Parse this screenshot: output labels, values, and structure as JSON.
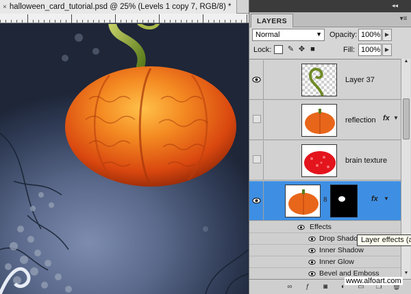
{
  "document": {
    "tab_title": "halloween_card_tutorial.psd @ 25% (Levels 1 copy 7, RGB/8) *",
    "close_glyph": "×"
  },
  "layers_panel": {
    "tab_label": "LAYERS",
    "blend_mode": "Normal",
    "opacity_label": "Opacity:",
    "opacity_value": "100%",
    "lock_label": "Lock:",
    "fill_label": "Fill:",
    "fill_value": "100%",
    "layers": [
      {
        "name": "Layer 37",
        "visible": true,
        "selected": false,
        "fx": false,
        "thumb": "vine-icon"
      },
      {
        "name": "reflection",
        "visible": false,
        "selected": false,
        "fx": true,
        "thumb": "pumpkin-icon"
      },
      {
        "name": "brain texture",
        "visible": false,
        "selected": false,
        "fx": false,
        "thumb": "red-texture-icon"
      },
      {
        "name": "",
        "visible": true,
        "selected": true,
        "fx": true,
        "thumb": "pumpkin-icon",
        "mask": true
      }
    ],
    "effects_label": "Effects",
    "effects": [
      "Drop Shadow",
      "Inner Shadow",
      "Inner Glow",
      "Bevel and Emboss"
    ],
    "fx_symbol": "fx"
  },
  "tooltip": "Layer effects (al",
  "watermark": "www.alfoart.com",
  "colors": {
    "selected_row": "#3e8fe3",
    "panel_bg": "#d6d6d6",
    "canvas_bg": "#5b6a8c",
    "pumpkin": "#e8661a"
  }
}
